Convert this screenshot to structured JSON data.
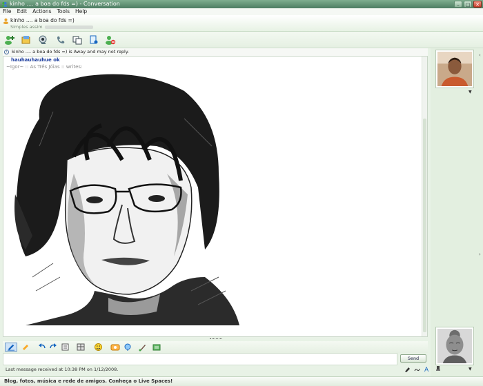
{
  "window": {
    "title": "kinho .... a boa do fds =) - Conversation"
  },
  "menu": {
    "items": [
      "File",
      "Edit",
      "Actions",
      "Tools",
      "Help"
    ]
  },
  "contact": {
    "name": "kinho .... a boa do fds =)",
    "status": "Simples assim"
  },
  "toolbar": {
    "icons": [
      "invite-contact-icon",
      "share-files-icon",
      "video-call-icon",
      "call-icon",
      "activities-icon",
      "games-icon",
      "block-icon"
    ]
  },
  "alert": {
    "text": "kinho .... a boa do fds =) is Away and may not reply."
  },
  "history": {
    "message": "hauhauhauhue ok",
    "writes": "~Igor~ :: As Três Jóias :: writes:"
  },
  "format": {
    "icons": [
      "pen-icon",
      "highlighter-icon",
      "undo-icon",
      "redo-icon",
      "font-icon",
      "background-icon",
      "emoticon-icon",
      "wink-icon",
      "nudge-icon",
      "brush-icon",
      "color-icon"
    ]
  },
  "input": {
    "send_label": "Send"
  },
  "status": {
    "last_message": "Last message received at 10:38 PM on 1/12/2008."
  },
  "ad": {
    "text": "Blog, fotos, música e rede de amigos. Conheça o Live Spaces!"
  },
  "colors": {
    "accent": "#4d7d62",
    "link": "#1a3b9c",
    "panel": "#e3efe0"
  }
}
